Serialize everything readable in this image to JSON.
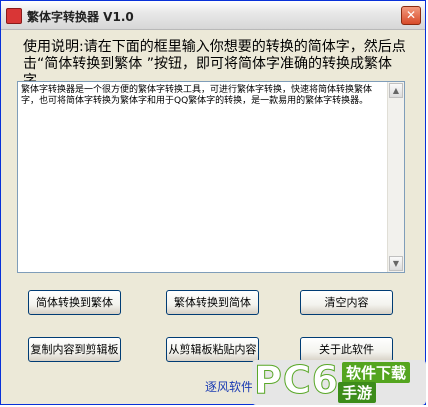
{
  "window": {
    "title": "繁体字转换器 V1.0",
    "close_symbol": "✕"
  },
  "instruction": "使用说明:请在下面的框里输入你想要的转换的简体字，然后点击“简体转换到繁体 ”按钮，即可将简体字准确的转换成繁体字。",
  "textarea": {
    "value": "繁体字转换器是一个很方便的繁体字转换工具，可进行繁体字转换，快速将简体转换繁体字，也可将简体字转换为繁体字和用于QQ繁体字的转换，是一款易用的繁体字转换器。"
  },
  "buttons": {
    "simp_to_trad": "简体转换到繁体",
    "trad_to_simp": "繁体转换到简体",
    "clear": "清空内容",
    "copy": "复制内容到剪辑板",
    "paste": "从剪辑板粘贴内容",
    "about": "关于此软件"
  },
  "footer_link": "逐风软件",
  "watermark": {
    "brand": "PC6",
    "line1": "软件下载",
    "line2": "手游"
  },
  "scrollbar": {
    "up_symbol": "▲",
    "down_symbol": "▼"
  }
}
